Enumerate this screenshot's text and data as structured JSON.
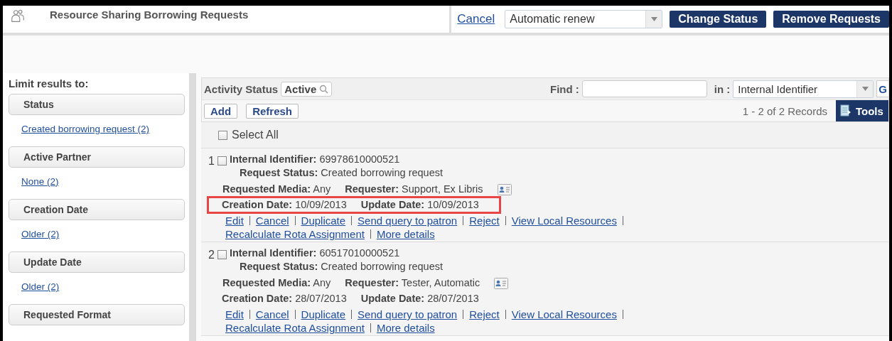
{
  "header": {
    "title": "Resource Sharing Borrowing Requests",
    "cancel": "Cancel",
    "status_select": "Automatic renew",
    "buttons": [
      "Change Status",
      "Remove Requests"
    ]
  },
  "sidebar": {
    "title": "Limit results to:",
    "facets": [
      {
        "heading": "Status",
        "options": [
          "Created borrowing request (2)"
        ]
      },
      {
        "heading": "Active Partner",
        "options": [
          "None (2)"
        ]
      },
      {
        "heading": "Creation Date",
        "options": [
          "Older (2)"
        ]
      },
      {
        "heading": "Update Date",
        "options": [
          "Older (2)"
        ]
      },
      {
        "heading": "Requested Format"
      }
    ]
  },
  "filter_bar": {
    "activity_label": "Activity Status",
    "activity_value": "Active",
    "find_label": "Find :",
    "in_label": "in :",
    "in_select": "Internal Identifier",
    "go": "G"
  },
  "toolbar": {
    "buttons": [
      "Add",
      "Refresh"
    ],
    "records": "1 - 2 of 2 Records",
    "tools": "Tools"
  },
  "select_all": {
    "label": "Select All",
    "checked": false
  },
  "rows": [
    {
      "number": "1",
      "checked": false,
      "highlighted": true,
      "id": {
        "label": "Internal Identifier:",
        "value": "69978610000521"
      },
      "status": {
        "label": "Request Status:",
        "value": "Created borrowing request"
      },
      "media": {
        "label": "Requested Media:",
        "value": "Any"
      },
      "requester": {
        "label": "Requester:",
        "value": "Support, Ex Libris"
      },
      "created": {
        "label": "Creation Date:",
        "value": "10/09/2013"
      },
      "updated": {
        "label": "Update Date:",
        "value": "10/09/2013"
      },
      "actions": [
        [
          "Edit",
          "Cancel",
          "Duplicate",
          "Send query to patron",
          "Reject",
          "View Local Resources"
        ],
        [
          "Recalculate Rota Assignment",
          "More details"
        ]
      ]
    },
    {
      "number": "2",
      "checked": false,
      "highlighted": false,
      "id": {
        "label": "Internal Identifier:",
        "value": "60517010000521"
      },
      "status": {
        "label": "Request Status:",
        "value": "Created borrowing request"
      },
      "media": {
        "label": "Requested Media:",
        "value": "Any"
      },
      "requester": {
        "label": "Requester:",
        "value": "Tester, Automatic"
      },
      "created": {
        "label": "Creation Date:",
        "value": "28/07/2013"
      },
      "updated": {
        "label": "Update Date:",
        "value": "28/07/2013"
      },
      "actions": [
        [
          "Edit",
          "Cancel",
          "Duplicate",
          "Send query to patron",
          "Reject",
          "View Local Resources"
        ],
        [
          "Recalculate Rota Assignment",
          "More details"
        ]
      ]
    }
  ]
}
